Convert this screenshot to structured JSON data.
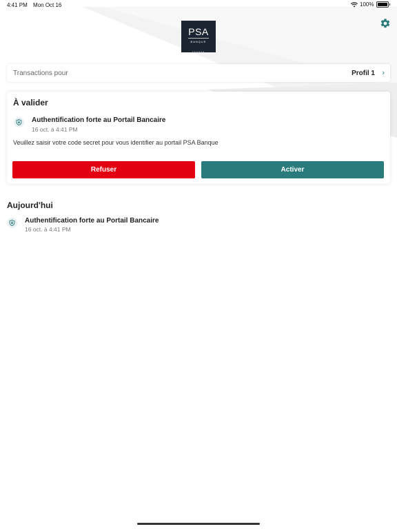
{
  "status_bar": {
    "time": "4:41 PM",
    "date": "Mon Oct 16",
    "battery": "100%"
  },
  "logo": {
    "main": "PSA",
    "sub": "BANQUE",
    "foot": "FRANCE"
  },
  "profile_bar": {
    "label": "Transactions pour",
    "value": "Profil 1"
  },
  "pending": {
    "title": "À valider",
    "item": {
      "title": "Authentification forte au Portail Bancaire",
      "date": "16 oct. à 4:41 PM",
      "description": "Veuillez saisir votre code secret pour vous identifier au portail PSA Banque"
    },
    "refuse_label": "Refuser",
    "activate_label": "Activer"
  },
  "today": {
    "title": "Aujourd'hui",
    "items": [
      {
        "title": "Authentification forte au Portail Bancaire",
        "date": "16 oct. à 4:41 PM"
      }
    ]
  },
  "colors": {
    "refuse": "#e30010",
    "accent": "#2a7b7b",
    "logo_bg": "#1b2431"
  },
  "icons": {
    "settings": "gear-icon",
    "chevron": "chevron-right-icon",
    "transaction": "shield-icon"
  }
}
